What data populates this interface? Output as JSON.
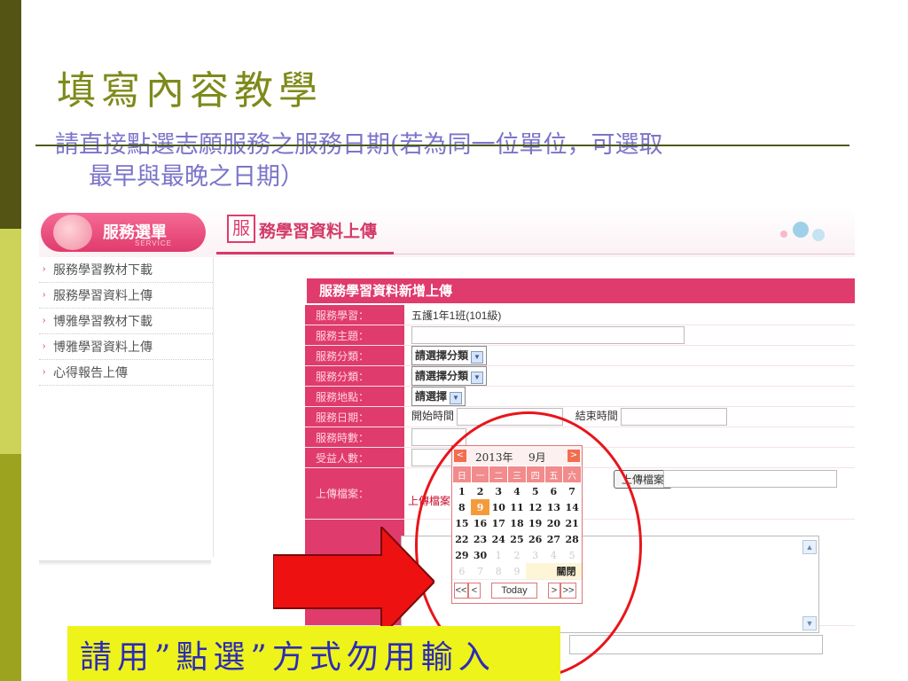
{
  "slide": {
    "title": "填寫內容教學",
    "subtitle_line1": "請直接點選志願服務之服務日期(若為同一位單位，可選取",
    "subtitle_line2": "最早與最晚之日期）",
    "note": "請用”點選”方式勿用輸入"
  },
  "colors": {
    "accent": "#e03b6d",
    "title": "#7e8a1a",
    "subtitle": "#7b74c9",
    "note_bg": "#eef31a",
    "highlight": "#e8151b"
  },
  "app": {
    "menu_title": "服務選單",
    "menu_sub": "SERVICE",
    "page_icon": "服",
    "page_title": "務學習資料上傳"
  },
  "sidebar": {
    "items": [
      {
        "label": "服務學習教材下載"
      },
      {
        "label": "服務學習資料上傳"
      },
      {
        "label": "博雅學習教材下載"
      },
      {
        "label": "博雅學習資料上傳"
      },
      {
        "label": "心得報告上傳"
      }
    ]
  },
  "form": {
    "title": "服務學習資料新增上傳",
    "labels": {
      "study": "服務學習：",
      "topic": "服務主題：",
      "category1": "服務分類：",
      "category2": "服務分類：",
      "location": "服務地點：",
      "date": "服務日期：",
      "hours": "服務時數：",
      "beneficiaries": "受益人數：",
      "upload": "上傳檔案："
    },
    "study_value": "五護1年1班(101級)",
    "category1_value": "請選擇分類",
    "category2_value": "請選擇分類",
    "location_value": "請選擇",
    "start_label": "開始時間",
    "end_label": "結束時間",
    "upload_button": "上傳檔案",
    "upload_link": "上傳檔案"
  },
  "calendar": {
    "year": "2013年",
    "month": "9月",
    "prev": "<",
    "next": ">",
    "weekdays": [
      "日",
      "一",
      "二",
      "三",
      "四",
      "五",
      "六"
    ],
    "weeks": [
      [
        "1",
        "2",
        "3",
        "4",
        "5",
        "6",
        "7"
      ],
      [
        "8",
        "9",
        "10",
        "11",
        "12",
        "13",
        "14"
      ],
      [
        "15",
        "16",
        "17",
        "18",
        "19",
        "20",
        "21"
      ],
      [
        "22",
        "23",
        "24",
        "25",
        "26",
        "27",
        "28"
      ],
      [
        "29",
        "30",
        "1",
        "2",
        "3",
        "4",
        "5"
      ],
      [
        "6",
        "7",
        "8",
        "9",
        "",
        "",
        ""
      ]
    ],
    "close_label": "關閉",
    "today_label": "Today",
    "prev_year": "<<",
    "prev_month": "<",
    "next_month": ">",
    "next_year": ">>"
  }
}
